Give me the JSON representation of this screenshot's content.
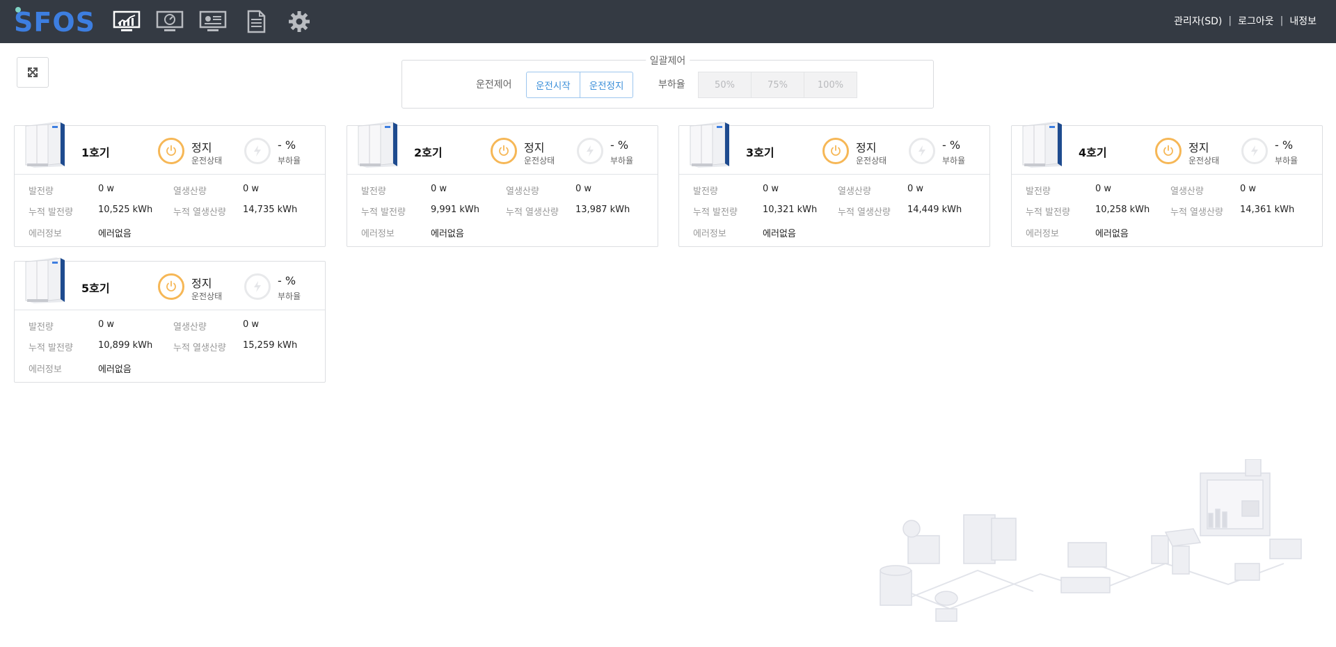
{
  "header": {
    "logo_text": "SFOS",
    "nav": [
      {
        "icon": "monitor-chart-icon"
      },
      {
        "icon": "monitor-gauge-icon"
      },
      {
        "icon": "monitor-presentation-icon"
      },
      {
        "icon": "document-icon"
      },
      {
        "icon": "gear-icon"
      }
    ],
    "user_label": "관리자(SD)",
    "logout_label": "로그아웃",
    "profile_label": "내정보"
  },
  "batch": {
    "title": "일괄제어",
    "operation_label": "운전제어",
    "start_label": "운전시작",
    "stop_label": "운전정지",
    "load_label": "부하율",
    "load_options": [
      "50%",
      "75%",
      "100%"
    ]
  },
  "labels": {
    "state_sub": "운전상태",
    "load_sub": "부하율",
    "gen": "발전량",
    "heat": "열생산량",
    "cum_gen": "누적 발전량",
    "cum_heat": "누적 열생산량",
    "error": "에러정보"
  },
  "units": [
    {
      "name": "1호기",
      "state": "정지",
      "load": "- %",
      "gen": "0 w",
      "heat": "0 w",
      "cum_gen": "10,525 kWh",
      "cum_heat": "14,735 kWh",
      "error": "에러없음"
    },
    {
      "name": "2호기",
      "state": "정지",
      "load": "- %",
      "gen": "0 w",
      "heat": "0 w",
      "cum_gen": "9,991 kWh",
      "cum_heat": "13,987 kWh",
      "error": "에러없음"
    },
    {
      "name": "3호기",
      "state": "정지",
      "load": "- %",
      "gen": "0 w",
      "heat": "0 w",
      "cum_gen": "10,321 kWh",
      "cum_heat": "14,449 kWh",
      "error": "에러없음"
    },
    {
      "name": "4호기",
      "state": "정지",
      "load": "- %",
      "gen": "0 w",
      "heat": "0 w",
      "cum_gen": "10,258 kWh",
      "cum_heat": "14,361 kWh",
      "error": "에러없음"
    },
    {
      "name": "5호기",
      "state": "정지",
      "load": "- %",
      "gen": "0 w",
      "heat": "0 w",
      "cum_gen": "10,899 kWh",
      "cum_heat": "15,259 kWh",
      "error": "에러없음"
    }
  ],
  "colors": {
    "topbar": "#343a43",
    "brand_blue": "#3d7ee0",
    "power_orange": "#f6b756",
    "button_blue": "#3b8fd9"
  }
}
